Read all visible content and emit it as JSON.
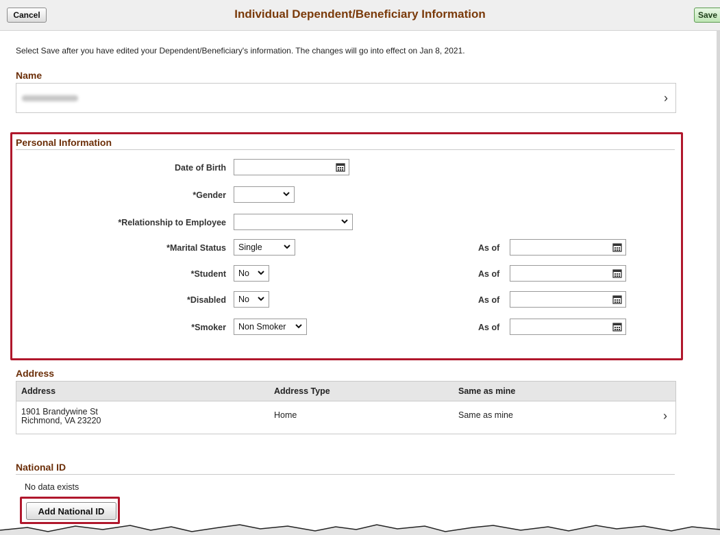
{
  "header": {
    "cancel_label": "Cancel",
    "title": "Individual Dependent/Beneficiary Information",
    "save_label": "Save"
  },
  "instruction": "Select Save after you have edited your Dependent/Beneficiary's information.  The changes will go into effect on Jan 8, 2021.",
  "name_section": {
    "label": "Name"
  },
  "personal_info": {
    "label": "Personal Information",
    "date_of_birth_label": "Date of Birth",
    "gender_label": "*Gender",
    "relationship_label": "*Relationship to Employee",
    "marital_status_label": "*Marital Status",
    "marital_status_value": "Single",
    "student_label": "*Student",
    "student_value": "No",
    "disabled_label": "*Disabled",
    "disabled_value": "No",
    "smoker_label": "*Smoker",
    "smoker_value": "Non Smoker",
    "as_of_label": "As of"
  },
  "address": {
    "label": "Address",
    "columns": [
      "Address",
      "Address Type",
      "Same as mine"
    ],
    "rows": [
      {
        "line1": "1901 Brandywine St",
        "line2": "Richmond, VA 23220",
        "type": "Home",
        "same": "Same as mine"
      }
    ]
  },
  "national_id": {
    "label": "National ID",
    "empty_text": "No data exists",
    "add_label": "Add National ID"
  },
  "colors": {
    "accent": "#b0172c",
    "heading": "#6b2e08",
    "title": "#7a3a0a"
  }
}
